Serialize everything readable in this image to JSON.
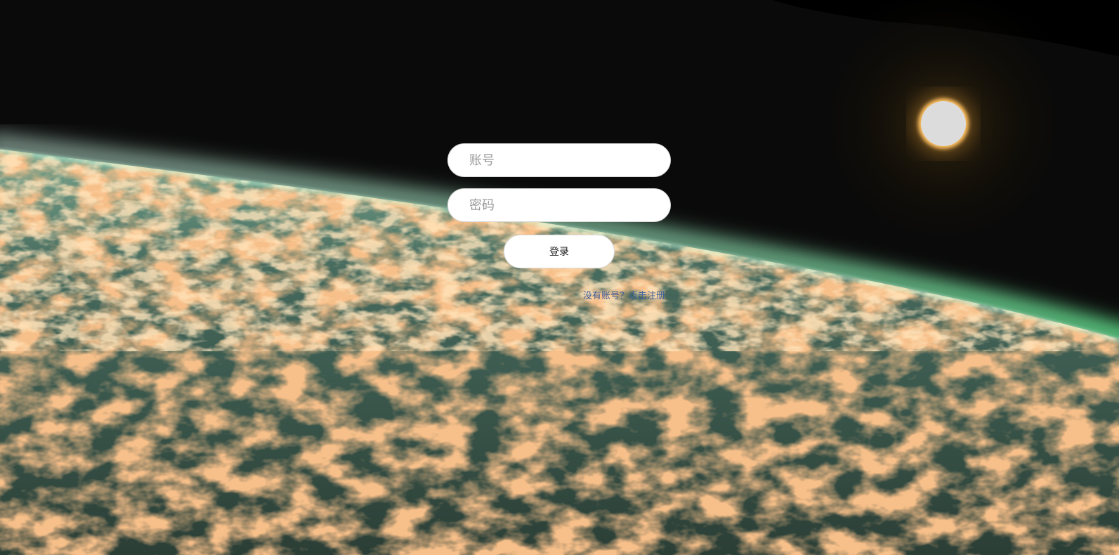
{
  "login": {
    "account_placeholder": "账号",
    "password_placeholder": "密码",
    "submit_label": "登录",
    "register_link": "没有账号？点击注册"
  },
  "colors": {
    "button_background": "#ffffff",
    "link": "#3d5f9c"
  }
}
